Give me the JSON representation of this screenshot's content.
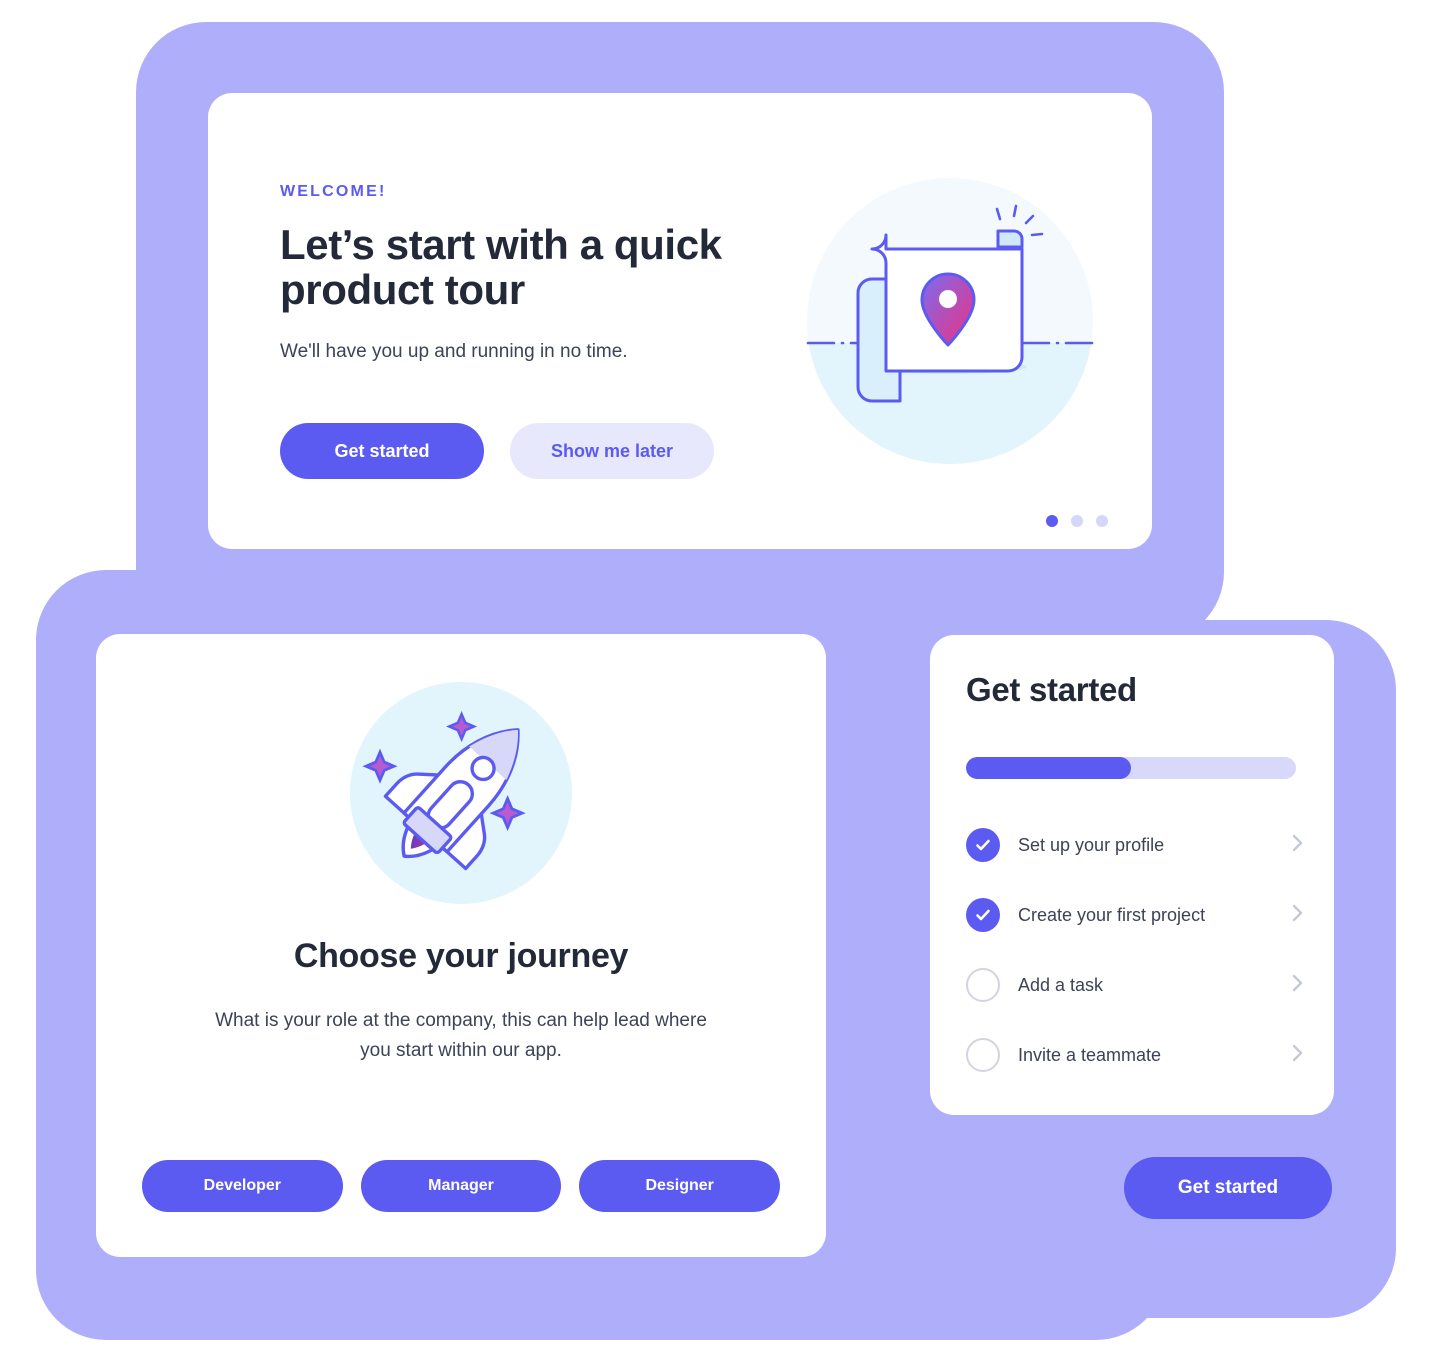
{
  "theme": {
    "accent": "#5b5bf2",
    "accent_soft": "#e8e8fc",
    "backdrop": "#aeaefb",
    "progress_track": "#d8d8fa",
    "text_dark": "#232939",
    "text_body": "#3d4357",
    "illustration_blue_circle": "#f3f8fe",
    "illustration_rocket_circle": "#e2f5fc"
  },
  "tour_card": {
    "eyebrow": "WELCOME!",
    "title": "Let’s start with a quick product tour",
    "subtitle": "We'll have you up and running in no time.",
    "primary_button": "Get started",
    "secondary_button": "Show me later",
    "illustration": "map-with-location-pin-icon",
    "pagination": {
      "total": 3,
      "active_index": 0
    }
  },
  "journey_card": {
    "illustration": "rocket-icon",
    "title": "Choose your journey",
    "subtitle": "What is your role at the company, this can help lead where you start within our app.",
    "roles": [
      {
        "label": "Developer"
      },
      {
        "label": "Manager"
      },
      {
        "label": "Designer"
      }
    ]
  },
  "checklist_card": {
    "title": "Get started",
    "progress_percent": 50,
    "items": [
      {
        "label": "Set up your profile",
        "done": true,
        "chevron": "chevron-right-icon"
      },
      {
        "label": "Create your first project",
        "done": true,
        "chevron": "chevron-right-icon"
      },
      {
        "label": "Add a task",
        "done": false,
        "chevron": "chevron-right-icon"
      },
      {
        "label": "Invite a teammate",
        "done": false,
        "chevron": "chevron-right-icon"
      }
    ]
  },
  "cta": {
    "label": "Get started"
  }
}
